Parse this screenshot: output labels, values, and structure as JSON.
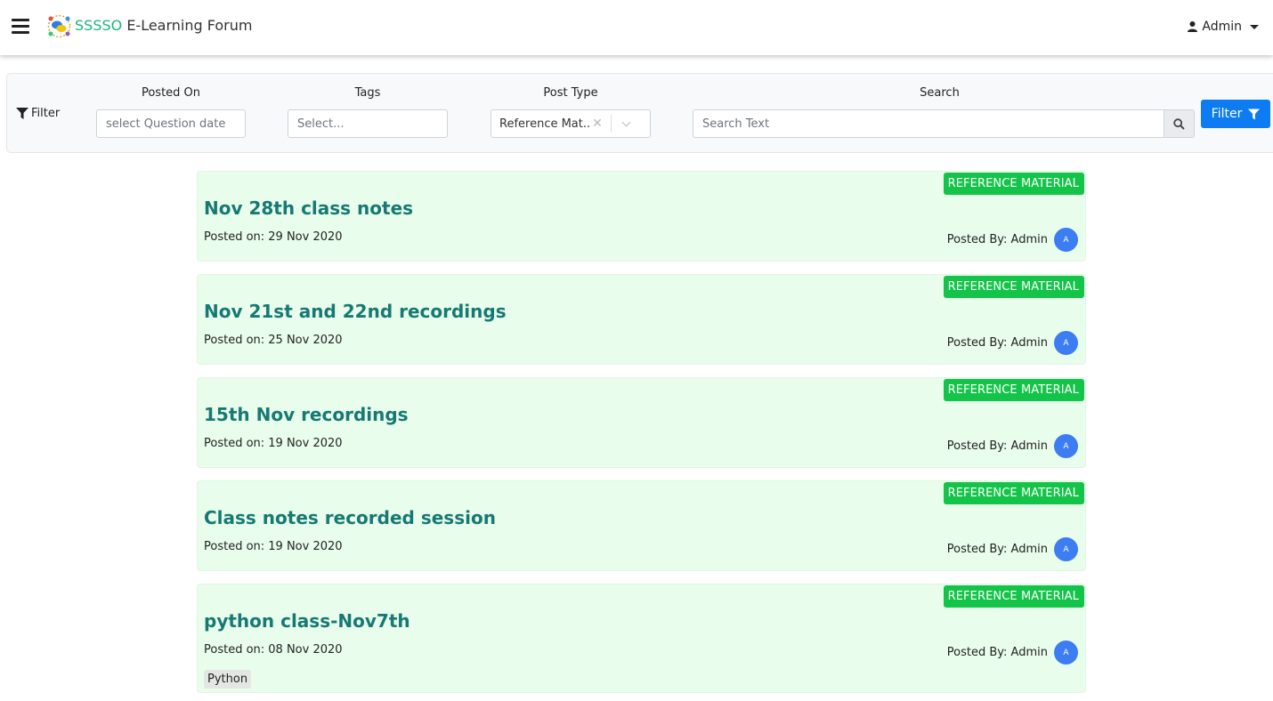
{
  "header": {
    "brand_primary": "SSSSO",
    "brand_secondary": "E-Learning Forum",
    "user_name": "Admin"
  },
  "filters": {
    "filter_label": "Filter",
    "posted_on_label": "Posted On",
    "posted_on_placeholder": "select Question date",
    "tags_label": "Tags",
    "tags_placeholder": "Select...",
    "post_type_label": "Post Type",
    "post_type_value": "Reference Mat...",
    "search_label": "Search",
    "search_placeholder": "Search Text",
    "filter_button": "Filter"
  },
  "colors": {
    "accent": "#0d7cf2",
    "badge": "#13c449",
    "title": "#167a73",
    "card_bg": "#e9fdec",
    "avatar": "#3c7df3"
  },
  "posts": [
    {
      "badge": "REFERENCE MATERIAL",
      "title": "Nov 28th class notes",
      "posted_on": "Posted on: 29 Nov 2020",
      "posted_by": "Posted By: Admin",
      "avatar": "A"
    },
    {
      "badge": "REFERENCE MATERIAL",
      "title": "Nov 21st and 22nd recordings",
      "posted_on": "Posted on: 25 Nov 2020",
      "posted_by": "Posted By: Admin",
      "avatar": "A"
    },
    {
      "badge": "REFERENCE MATERIAL",
      "title": "15th Nov recordings",
      "posted_on": "Posted on: 19 Nov 2020",
      "posted_by": "Posted By: Admin",
      "avatar": "A"
    },
    {
      "badge": "REFERENCE MATERIAL",
      "title": "Class notes recorded session",
      "posted_on": "Posted on: 19 Nov 2020",
      "posted_by": "Posted By: Admin",
      "avatar": "A"
    },
    {
      "badge": "REFERENCE MATERIAL",
      "title": "python class-Nov7th",
      "posted_on": "Posted on: 08 Nov 2020",
      "posted_by": "Posted By: Admin",
      "avatar": "A",
      "tag": "Python"
    }
  ]
}
